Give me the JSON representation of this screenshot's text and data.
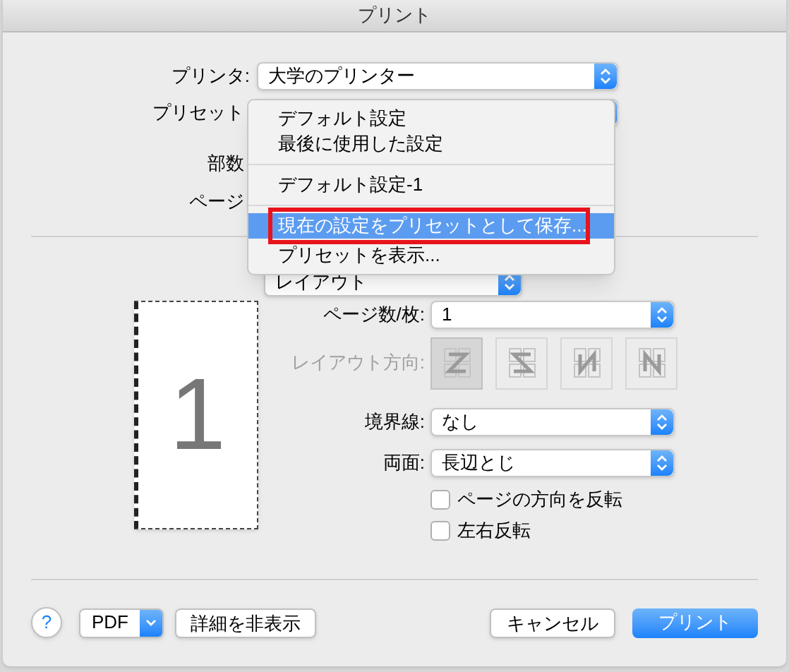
{
  "window": {
    "title": "プリント"
  },
  "printer": {
    "label": "プリンタ:",
    "value": "大学のプリンター"
  },
  "preset": {
    "label": "プリセット"
  },
  "copies": {
    "label": "部数"
  },
  "pages": {
    "label": "ページ"
  },
  "preset_menu": {
    "items": [
      {
        "kind": "item",
        "label": "デフォルト設定",
        "selected": false
      },
      {
        "kind": "item",
        "label": "最後に使用した設定",
        "selected": false
      },
      {
        "kind": "separator"
      },
      {
        "kind": "item",
        "label": "デフォルト設定-1",
        "selected": false
      },
      {
        "kind": "separator"
      },
      {
        "kind": "item",
        "label": "現在の設定をプリセットとして保存...",
        "selected": true,
        "highlighted": true
      },
      {
        "kind": "item",
        "label": "プリセットを表示...",
        "selected": false
      }
    ]
  },
  "section_popup": {
    "value": "レイアウト"
  },
  "preview": {
    "page_number": "1"
  },
  "layout": {
    "pages_per_sheet": {
      "label": "ページ数/枚:",
      "value": "1"
    },
    "direction": {
      "label": "レイアウト方向:",
      "disabled": true,
      "options": [
        {
          "kind": "z",
          "selected": true
        },
        {
          "kind": "s",
          "selected": false
        },
        {
          "kind": "n-reverse",
          "selected": false
        },
        {
          "kind": "n",
          "selected": false
        }
      ]
    },
    "border": {
      "label": "境界線:",
      "value": "なし"
    },
    "two_sided": {
      "label": "両面:",
      "value": "長辺とじ"
    },
    "checkboxes": [
      {
        "label": "ページの方向を反転",
        "checked": false
      },
      {
        "label": "左右反転",
        "checked": false
      }
    ]
  },
  "footer": {
    "help": "?",
    "pdf": "PDF",
    "hide_details": "詳細を非表示",
    "cancel": "キャンセル",
    "print": "プリント"
  }
}
